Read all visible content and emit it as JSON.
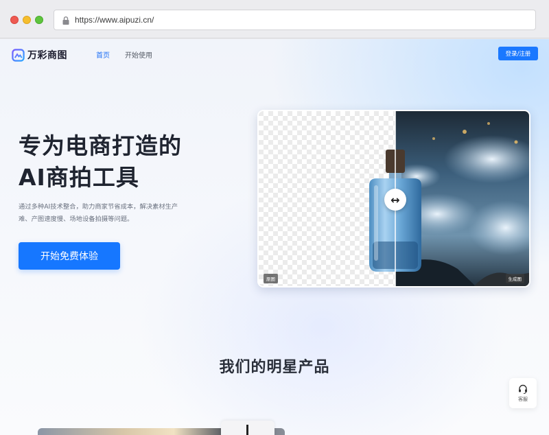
{
  "browser": {
    "url": "https://www.aipuzi.cn/"
  },
  "header": {
    "brand": "万彩商图",
    "nav": [
      {
        "label": "首页",
        "active": true
      },
      {
        "label": "开始使用",
        "active": false
      }
    ],
    "login_label": "登录/注册"
  },
  "hero": {
    "title_line1": "专为电商打造的",
    "title_line2": "AI商拍工具",
    "desc_line1": "通过多种AI技术整合，助力商家节省成本，解决素材生产",
    "desc_line2": "难、产图速度慢、场地设备拍摄等问题。",
    "cta_label": "开始免费体验"
  },
  "compare": {
    "left_tag": "原图",
    "right_tag": "生成图",
    "handle_icon": "left-right-arrow-icon"
  },
  "products": {
    "title": "我们的明星产品"
  },
  "support": {
    "label": "客服",
    "icon": "headset-icon"
  },
  "colors": {
    "accent": "#1677ff",
    "nav_active": "#1f6ff5",
    "title_text": "#1f2430"
  }
}
